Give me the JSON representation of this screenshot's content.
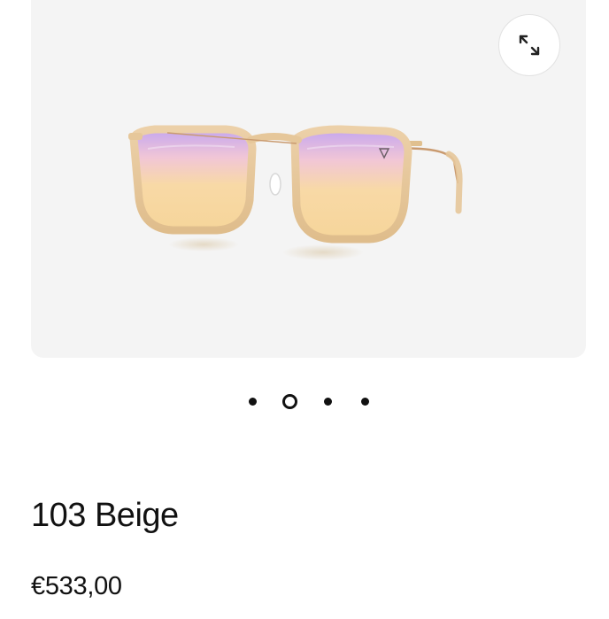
{
  "product": {
    "name": "103 Beige",
    "price": "€533,00"
  },
  "gallery": {
    "image_icon": "sunglasses-image",
    "expand_icon": "expand-icon",
    "slide_count": 4,
    "active_slide": 2
  },
  "colors": {
    "gallery_background": "#f4f4f4",
    "frame_beige": "#e6c79a",
    "temple_copper": "#c99a6f",
    "lens_gold": "#f6d59a",
    "lens_violet": "#c5a6f0",
    "text": "#111111"
  }
}
